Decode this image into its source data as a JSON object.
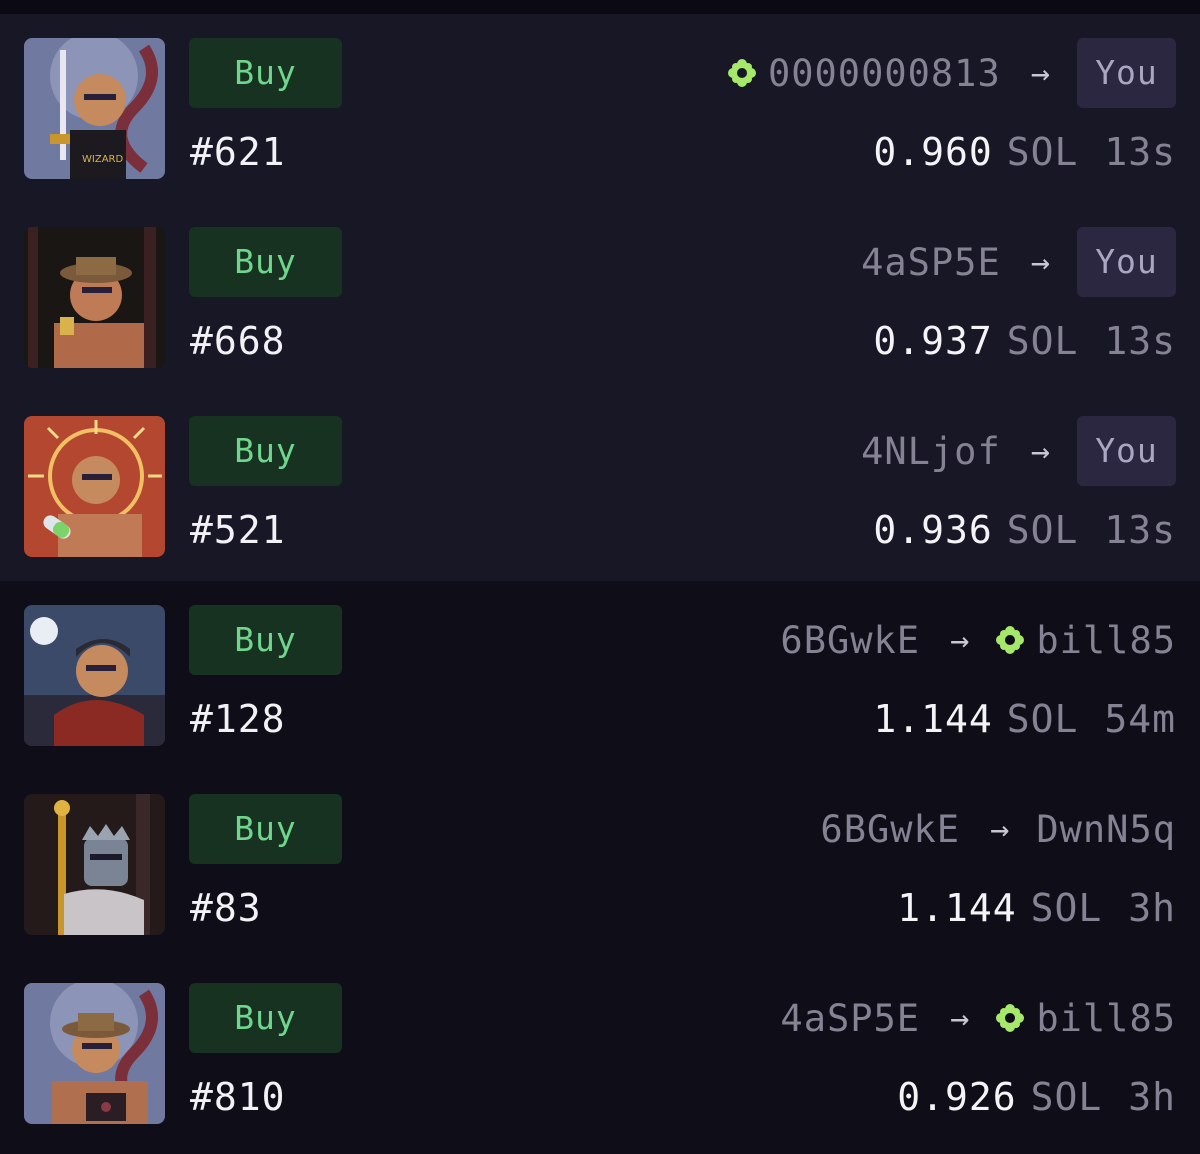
{
  "buy_label": "Buy",
  "you_label": "You",
  "arrow": "→",
  "currency": "SOL",
  "colors": {
    "buy_bg": "#173221",
    "buy_text": "#6fd68c",
    "verified": "#a6e86a",
    "you_bg": "#2b2740"
  },
  "rows": [
    {
      "token": "#621",
      "from": "0000000813",
      "from_verified": true,
      "to": "You",
      "amount": "0.960",
      "age": "13s",
      "bg": "#6e7aa0",
      "art": "snake-sword-wizard"
    },
    {
      "token": "#668",
      "from": "4aSP5E",
      "from_verified": false,
      "to": "You",
      "amount": "0.937",
      "age": "13s",
      "bg": "#1a1614",
      "art": "forest-hat"
    },
    {
      "token": "#521",
      "from": "4NLjof",
      "from_verified": false,
      "to": "You",
      "amount": "0.936",
      "age": "13s",
      "bg": "#b4472f",
      "art": "sun-pill"
    },
    {
      "token": "#128",
      "from": "6BGwkE",
      "from_verified": false,
      "to": "bill85",
      "to_verified": true,
      "amount": "1.144",
      "age": "54m",
      "bg": "#3c4a6a",
      "art": "moon-scarf"
    },
    {
      "token": "#83",
      "from": "6BGwkE",
      "from_verified": false,
      "to": "DwnN5q",
      "to_verified": false,
      "amount": "1.144",
      "age": "3h",
      "bg": "#241a1a",
      "art": "knight-scepter"
    },
    {
      "token": "#810",
      "from": "4aSP5E",
      "from_verified": false,
      "to": "bill85",
      "to_verified": true,
      "amount": "0.926",
      "age": "3h",
      "bg": "#6e7aa0",
      "art": "snake-hat-book"
    }
  ]
}
